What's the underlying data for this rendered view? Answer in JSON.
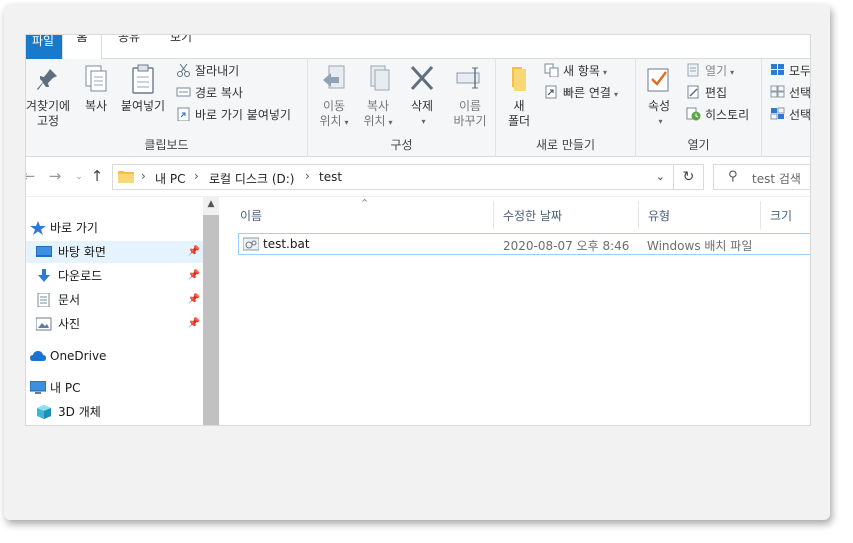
{
  "ribbon_tabs": {
    "file": "파일",
    "home": "홈",
    "share": "공유",
    "view": "보기"
  },
  "clipboard": {
    "pin_label": "즐겨찾기에\n고정",
    "pin_line1": "겨찾기에",
    "pin_line2": "고정",
    "copy": "복사",
    "paste": "붙여넣기",
    "cut": "잘라내기",
    "copy_path": "경로 복사",
    "paste_shortcut": "바로 가기 붙여넣기",
    "group": "클립보드"
  },
  "organize": {
    "move_line1": "이동",
    "move_line2": "위치",
    "copy_line1": "복사",
    "copy_line2": "위치",
    "delete": "삭제",
    "rename_line1": "이름",
    "rename_line2": "바꾸기",
    "group": "구성"
  },
  "new": {
    "folder_line1": "새",
    "folder_line2": "폴더",
    "new_item": "새 항목",
    "easy_access": "빠른 연결",
    "group": "새로 만들기"
  },
  "open": {
    "properties": "속성",
    "open": "열기",
    "edit": "편집",
    "history": "히스토리",
    "group": "열기"
  },
  "select": {
    "select_all": "모두",
    "select_none": "선택",
    "invert": "선택"
  },
  "address": {
    "crumbs": [
      "내 PC",
      "로컬 디스크 (D:)",
      "test"
    ],
    "search_placeholder": "test 검색"
  },
  "nav_pane": {
    "quick_access": "바로 가기",
    "items": [
      {
        "label": "바탕 화면",
        "pinned": true,
        "selected": true
      },
      {
        "label": "다운로드",
        "pinned": true
      },
      {
        "label": "문서",
        "pinned": true
      },
      {
        "label": "사진",
        "pinned": true
      }
    ],
    "onedrive": "OneDrive",
    "this_pc": "내 PC",
    "objects3d": "3D 개체"
  },
  "columns": {
    "name": "이름",
    "date": "수정한 날짜",
    "type": "유형",
    "size": "크기"
  },
  "files": [
    {
      "name": "test.bat",
      "date": "2020-08-07 오후 8:46",
      "type": "Windows 배치 파일"
    }
  ],
  "colors": {
    "accent": "#1979ca",
    "selection": "#e5f3ff",
    "row_border": "#99d1ff"
  }
}
